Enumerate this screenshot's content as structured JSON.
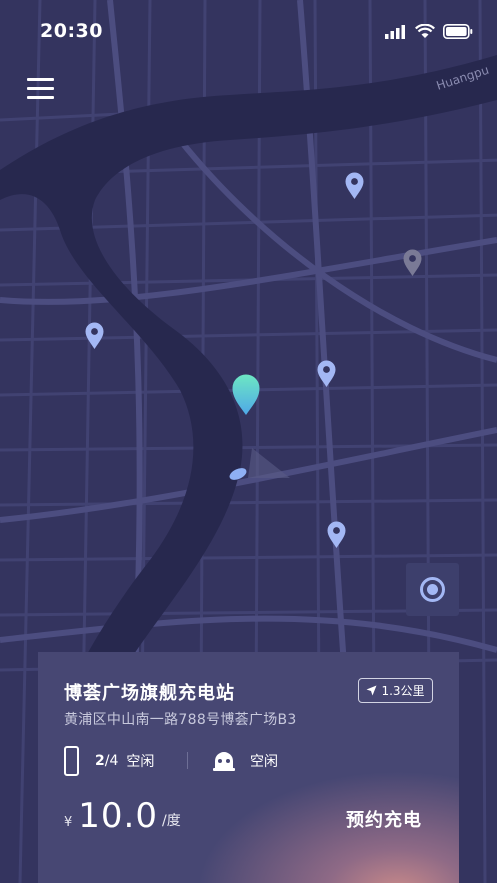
{
  "status_bar": {
    "time": "20:30"
  },
  "map": {
    "river_label": "Huangpu",
    "colors": {
      "background": "#34345f",
      "road": "#4a4b7a",
      "river": "#27284e",
      "pin": "#a3b7f4",
      "pin_inactive": "#7a7a96",
      "pin_selected": "#5fe0c8"
    }
  },
  "station": {
    "name": "博荟广场旗舰充电站",
    "distance": "1.3公里",
    "address": "黄浦区中山南一路788号博荟广场B3",
    "slots_available": "2",
    "slots_total": "/4",
    "slots_status": "空闲",
    "parking_status": "空闲",
    "price_symbol": "¥",
    "price": "10.0",
    "price_unit": "/度",
    "reserve_label": "预约充电"
  }
}
